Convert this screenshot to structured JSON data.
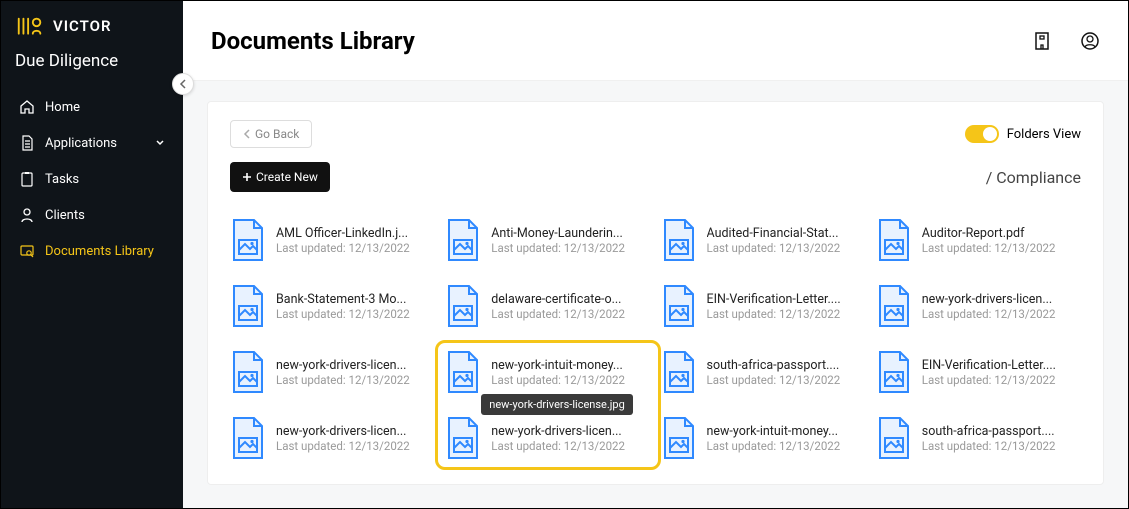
{
  "brand": {
    "name": "VICTOR"
  },
  "module": "Due Diligence",
  "sidebar": {
    "items": [
      {
        "label": "Home",
        "icon": "home"
      },
      {
        "label": "Applications",
        "icon": "doc",
        "expandable": true
      },
      {
        "label": "Tasks",
        "icon": "clipboard"
      },
      {
        "label": "Clients",
        "icon": "person"
      },
      {
        "label": "Documents Library",
        "icon": "folder-search",
        "active": true
      }
    ]
  },
  "header": {
    "title": "Documents Library"
  },
  "panel": {
    "go_back": "Go Back",
    "toggle_label": "Folders View",
    "create_new": "Create New",
    "breadcrumb": "/ Compliance",
    "last_updated_prefix": "Last updated: "
  },
  "tooltip": "new-york-drivers-license.jpg",
  "files": [
    {
      "name": "AML Officer-LinkedIn.j...",
      "date": "12/13/2022"
    },
    {
      "name": "Anti-Money-Launderin...",
      "date": "12/13/2022"
    },
    {
      "name": "Audited-Financial-Stat...",
      "date": "12/13/2022"
    },
    {
      "name": "Auditor-Report.pdf",
      "date": "12/13/2022"
    },
    {
      "name": "Bank-Statement-3 Mo...",
      "date": "12/13/2022"
    },
    {
      "name": "delaware-certificate-o...",
      "date": "12/13/2022"
    },
    {
      "name": "EIN-Verification-Letter....",
      "date": "12/13/2022"
    },
    {
      "name": "new-york-drivers-licen...",
      "date": "12/13/2022"
    },
    {
      "name": "new-york-drivers-licen...",
      "date": "12/13/2022"
    },
    {
      "name": "new-york-intuit-money...",
      "date": "12/13/2022"
    },
    {
      "name": "south-africa-passport....",
      "date": "12/13/2022"
    },
    {
      "name": "EIN-Verification-Letter....",
      "date": "12/13/2022"
    },
    {
      "name": "new-york-drivers-licen...",
      "date": "12/13/2022"
    },
    {
      "name": "new-york-drivers-licen...",
      "date": "12/13/2022"
    },
    {
      "name": "new-york-intuit-money...",
      "date": "12/13/2022"
    },
    {
      "name": "south-africa-passport....",
      "date": "12/13/2022"
    }
  ],
  "colors": {
    "accent": "#f5c518",
    "file_blue": "#2f89ff"
  }
}
